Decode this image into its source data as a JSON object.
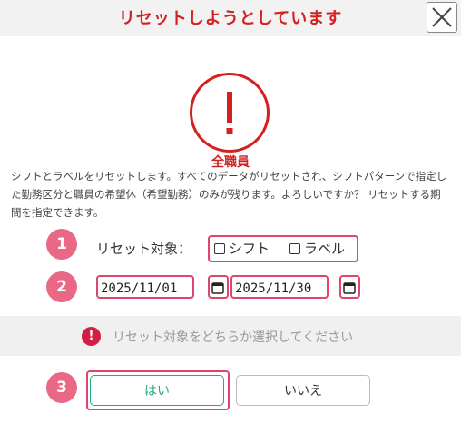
{
  "dialog": {
    "title": "リセットしようとしています",
    "close_icon": "close-icon",
    "warning_icon": "exclamation-icon",
    "scope_label": "全職員",
    "description": "シフトとラベルをリセットします。すべてのデータがリセットされ、シフトパターンで指定した勤務区分と職員の希望休（希望勤務）のみが残ります。よろしいですか？ リセットする期間を指定できます。"
  },
  "steps": [
    "1",
    "2",
    "3"
  ],
  "reset_target": {
    "label": "リセット対象：",
    "options": [
      {
        "label": "シフト",
        "checked": false
      },
      {
        "label": "ラベル",
        "checked": false
      }
    ]
  },
  "period": {
    "start": "2025/11/01",
    "end": "2025/11/30",
    "calendar_icon": "calendar-icon"
  },
  "notice": {
    "icon": "alert-icon",
    "text": "リセット対象をどちらか選択してください"
  },
  "buttons": {
    "yes": "はい",
    "no": "いいえ"
  },
  "colors": {
    "title_red": "#d42020",
    "highlight_pink": "#e0466b",
    "badge_pink": "#e96886",
    "yes_green": "#2aa880",
    "notice_red": "#d21d45"
  }
}
